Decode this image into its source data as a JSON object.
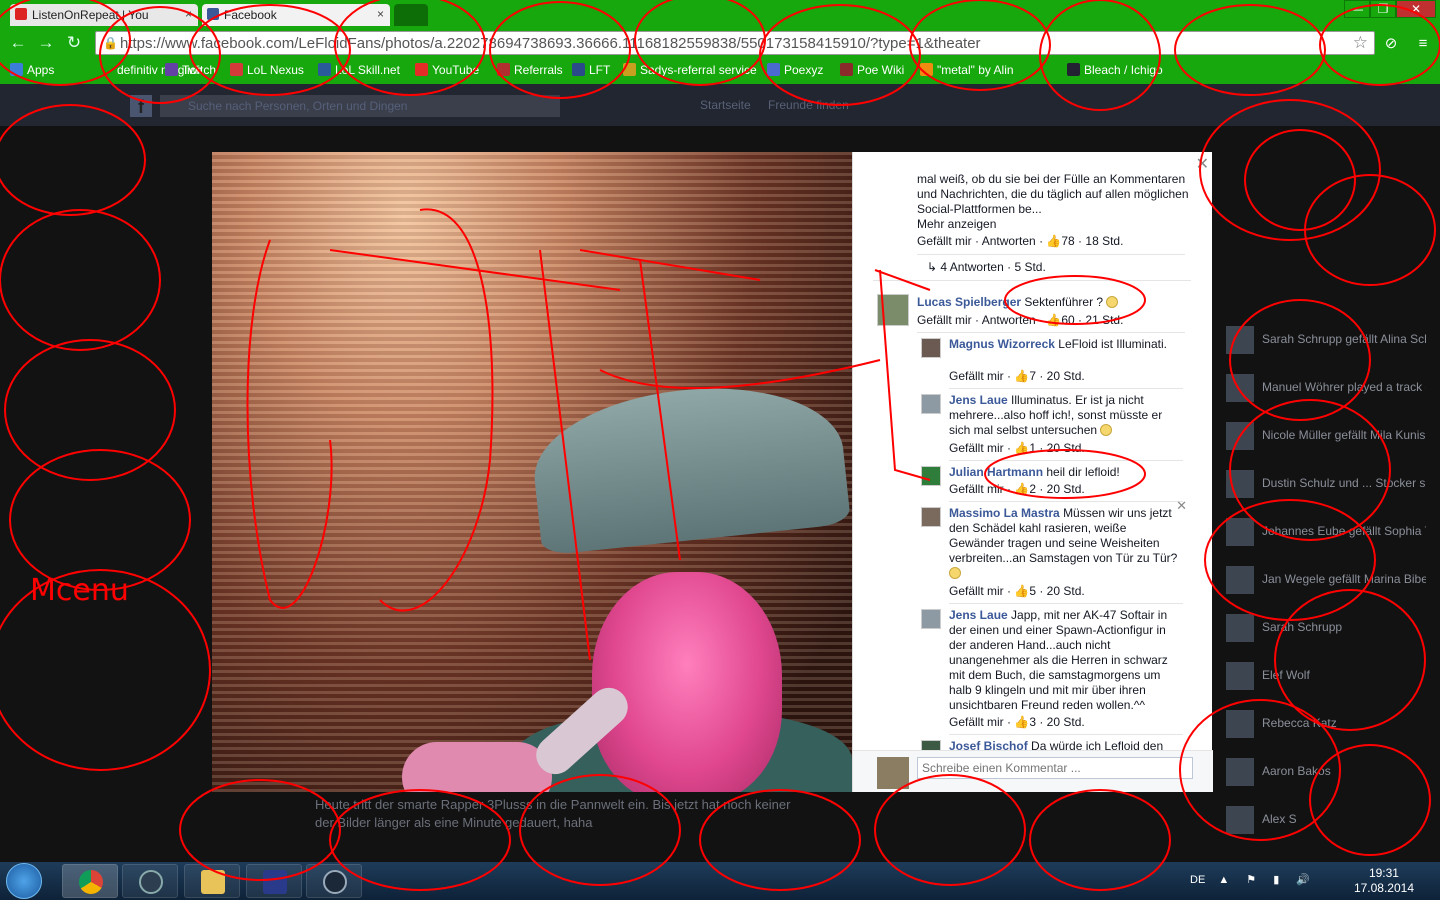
{
  "browser": {
    "tabs": [
      {
        "label": "ListenOnRepeat | You",
        "close": "×"
      },
      {
        "label": "Facebook",
        "close": "×"
      },
      {
        "label": ""
      }
    ],
    "window_controls": [
      "—",
      "❐",
      "✕"
    ],
    "url": "https://www.facebook.com/LeFloidFans/photos/a.220278694738693.36666.11168182559838/550173158415910/?type=1&theater",
    "bookmarks": [
      {
        "label": "Apps",
        "color": "#3c7dd9"
      },
      {
        "label": "definitiv möglich",
        "color": "#16a80c"
      },
      {
        "label": "Twitch",
        "color": "#6441a5"
      },
      {
        "label": "LoL Nexus",
        "color": "#d43a3a"
      },
      {
        "label": "LoL Skill.net",
        "color": "#2a5a9a"
      },
      {
        "label": "YouTube",
        "color": "#e52d27"
      },
      {
        "label": "Referrals",
        "color": "#b03030"
      },
      {
        "label": "LFT",
        "color": "#2a4a8a"
      },
      {
        "label": "Sadys-referral service",
        "color": "#c8a020"
      },
      {
        "label": "Poexyz",
        "color": "#4a6ad0"
      },
      {
        "label": "Poe Wiki",
        "color": "#8a2a2a"
      },
      {
        "label": "\"metal\" by Alin",
        "color": "#f08a10"
      },
      {
        "label": "Bleach / Ichigo",
        "color": "#223"
      }
    ]
  },
  "facebook": {
    "search_placeholder": "Suche nach Personen, Orten und Dingen",
    "nav": [
      "Startseite",
      "Freunde finden"
    ],
    "caption": "Heute tritt der smarte Rapper 3Plusss in die Pannwelt ein. Bis jetzt hat noch keiner der Bilder länger als eine Minute gedauert, haha"
  },
  "comments": {
    "top_text": "mal weiß, ob du sie bei der Fülle an Kommentaren und Nachrichten, die du täglich auf allen möglichen Social-Plattformen be...",
    "more": "Mehr anzeigen",
    "top_meta": {
      "like": "Gefällt mir",
      "reply": "Antworten",
      "count": "78",
      "time": "18 Std."
    },
    "replies_link": "4 Antworten",
    "replies_time": "5 Std.",
    "items": [
      {
        "name": "Lucas Spielberger",
        "text": "Sektenführer ?",
        "like": "Gefällt mir",
        "reply": "Antworten",
        "count": "60",
        "time": "21 Std."
      },
      {
        "name": "Magnus Wizorreck",
        "text": "LeFloid ist Illuminati.",
        "like": "Gefällt mir",
        "count": "7",
        "time": "20 Std."
      },
      {
        "name": "Jens Laue",
        "text": "Illuminatus. Er ist ja nicht mehrere...also hoff ich!, sonst müsste er sich mal selbst untersuchen",
        "like": "Gefällt mir",
        "count": "1",
        "time": "20 Std."
      },
      {
        "name": "Julian Hartmann",
        "text": "heil dir lefloid!",
        "like": "Gefällt mir",
        "count": "2",
        "time": "20 Std."
      },
      {
        "name": "Massimo La Mastra",
        "text": "Müssen wir uns jetzt den Schädel kahl rasieren, weiße Gewänder tragen und seine Weisheiten verbreiten...an Samstagen von Tür zu Tür?",
        "like": "Gefällt mir",
        "count": "5",
        "time": "20 Std."
      },
      {
        "name": "Jens Laue",
        "text": "Japp, mit ner AK-47 Softair in der einen und einer Spawn-Actionfigur in der anderen Hand...auch nicht unangenehmer als die Herren in schwarz mit dem Buch, die samstagmorgens um halb 9 klingeln und mit mir über ihren unsichtbaren Freund reden wollen.^^",
        "like": "Gefällt mir",
        "count": "3",
        "time": "20 Std."
      },
      {
        "name": "Josef Bischof",
        "text": "Da würde ich Lefloid den"
      }
    ],
    "input_placeholder": "Schreibe einen Kommentar ..."
  },
  "ticker": [
    {
      "text": "Sarah Schrupp gefällt Alina Schmids Foto."
    },
    {
      "text": "Manuel Wöhrer played a track on SoundCloud."
    },
    {
      "text": "Nicole Müller gefällt Mila Kunis Foto."
    },
    {
      "text": "Dustin Schulz und ... Stocker sind jetzt Freunde."
    },
    {
      "text": "Johannes Eube gefällt Sophia Tals Foto."
    },
    {
      "text": "Jan Wegele gefällt Marina Biberthalers Foto."
    },
    {
      "text": "Sarah Schrupp"
    },
    {
      "text": "Elef Wolf"
    },
    {
      "text": "Rebecca Katz"
    },
    {
      "text": "Aaron Bakos"
    },
    {
      "text": "Alex S"
    }
  ],
  "scribble_text": "Mcenu",
  "taskbar": {
    "lang": "DE",
    "time": "19:31",
    "date": "17.08.2014"
  },
  "colors": {
    "browser_frame": "#16a80c",
    "facebook_link": "#3b5998",
    "scribble": "#ff0000"
  }
}
